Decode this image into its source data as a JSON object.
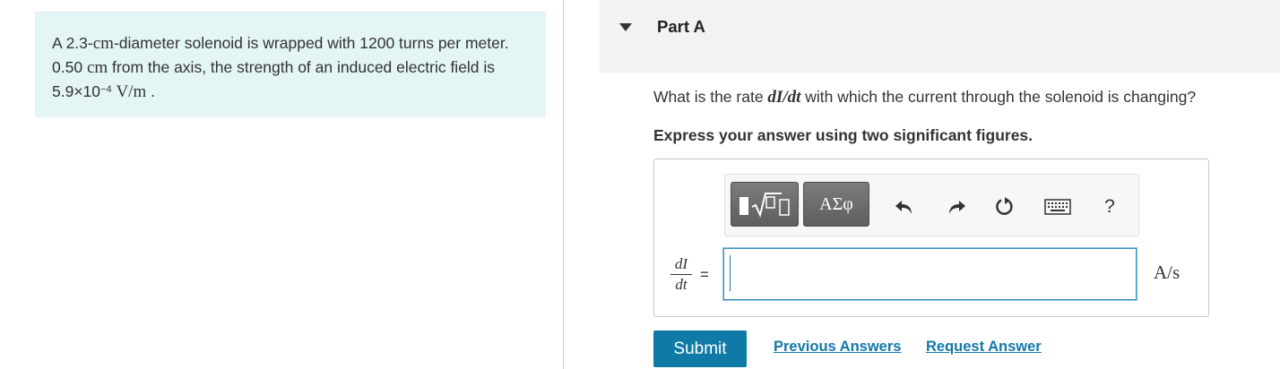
{
  "problem": {
    "text_1": "A 2.3-",
    "unit_cm_1": "cm",
    "text_2": "-diameter solenoid is wrapped with 1200 turns per meter. 0.50 ",
    "unit_cm_2": "cm",
    "text_3": " from the axis, the strength of an induced electric field is 5.9×10",
    "exponent": "−4",
    "field_unit": "V/m",
    "text_end": " ."
  },
  "part": {
    "title": "Part A",
    "question_prefix": "What is the rate ",
    "question_symbol": "dI/dt",
    "question_suffix": " with which the current through the solenoid is changing?",
    "instruction": "Express your answer using two significant figures."
  },
  "toolbar": {
    "templates_label": "▮√▯",
    "symbols_label": "ΑΣφ",
    "undo_icon": "undo-icon",
    "redo_icon": "redo-icon",
    "reset_icon": "reset-icon",
    "keyboard_icon": "keyboard-icon",
    "help_label": "?"
  },
  "answer": {
    "frac_numerator": "dI",
    "frac_denominator": "dt",
    "equals": "=",
    "value": "",
    "unit": "A/s"
  },
  "actions": {
    "submit": "Submit",
    "previous_answers": "Previous Answers",
    "request_answer": "Request Answer"
  },
  "colors": {
    "problem_bg": "#e4f5f6",
    "header_bg": "#f2f2f2",
    "submit_bg": "#0f7aa5",
    "link": "#1478a8"
  }
}
